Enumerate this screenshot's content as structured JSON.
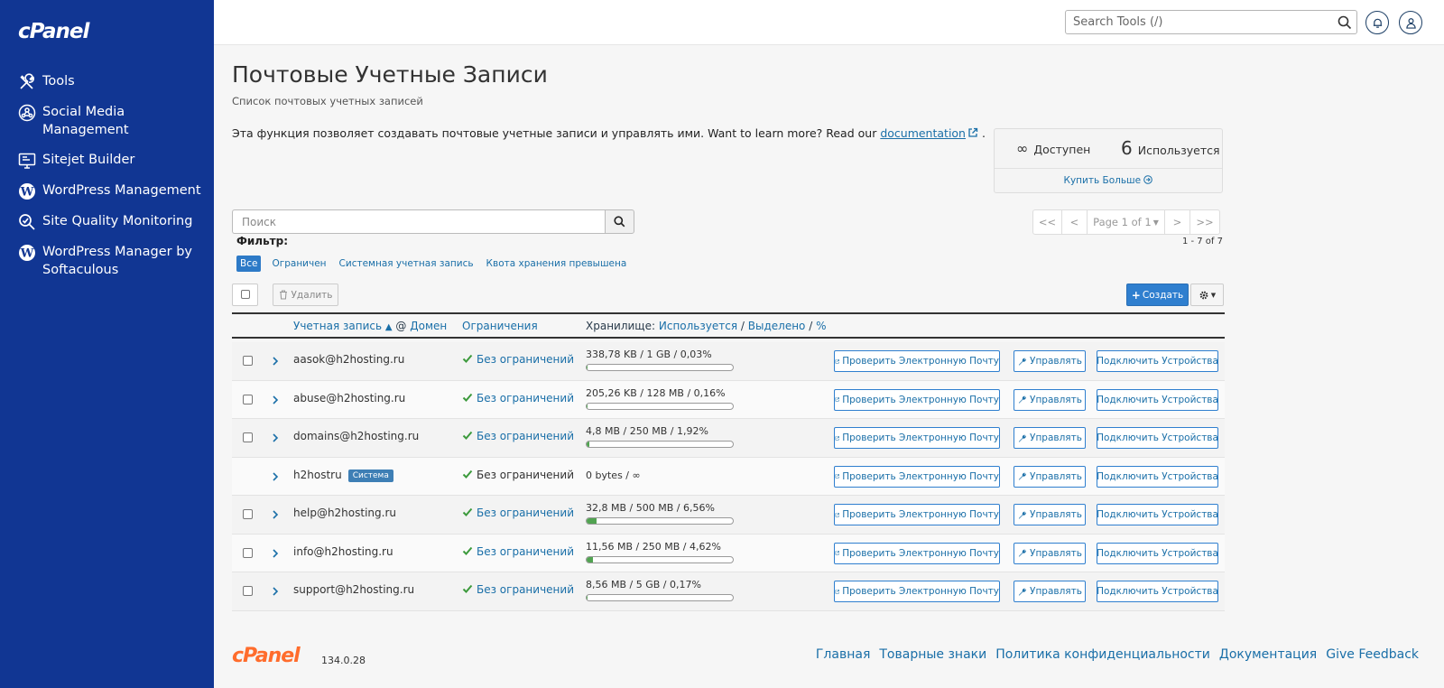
{
  "brand": {
    "logo": "cPanel",
    "footer_logo": "cPanel",
    "version": "134.0.28"
  },
  "sidebar": {
    "items": [
      {
        "label": "Tools",
        "icon": "tools-icon"
      },
      {
        "label": "Social Media Management",
        "icon": "social-media-icon"
      },
      {
        "label": "Sitejet Builder",
        "icon": "sitejet-icon"
      },
      {
        "label": "WordPress Management",
        "icon": "wordpress-icon"
      },
      {
        "label": "Site Quality Monitoring",
        "icon": "magnifier-icon"
      },
      {
        "label": "WordPress Manager by Softaculous",
        "icon": "wordpress-icon"
      }
    ]
  },
  "topbar": {
    "search_placeholder": "Search Tools (/)"
  },
  "page": {
    "title": "Почтовые Учетные Записи",
    "subtitle": "Список почтовых учетных записей",
    "intro": "Эта функция позволяет создавать почтовые учетные записи и управлять ими. Want to learn more? Read our ",
    "intro_link": "documentation",
    "intro_end": "."
  },
  "stats": {
    "available_value": "∞",
    "available_label": "Доступен",
    "used_value": "6",
    "used_label": "Используется",
    "buy_more": "Купить Больше"
  },
  "search": {
    "placeholder": "Поиск"
  },
  "pagination": {
    "first": "<<",
    "prev": "<",
    "page": "Page 1 of 1",
    "next": ">",
    "last": ">>",
    "range": "1 - 7 of 7"
  },
  "filter": {
    "label": "Фильтр:",
    "options": [
      "Все",
      "Ограничен",
      "Системная учетная запись",
      "Квота хранения превышена"
    ]
  },
  "toolbar": {
    "delete": "Удалить",
    "create": "Создать"
  },
  "table": {
    "header": {
      "account": "Учетная запись",
      "at": "@",
      "domain": "Домен",
      "limits": "Ограничения",
      "storage": "Хранилище:",
      "used": "Используется",
      "sep1": "/",
      "allocated": "Выделено",
      "sep2": "/",
      "percent": "%"
    },
    "buttons": {
      "check": "Проверить Электронную Почту",
      "manage": "Управлять",
      "connect": "Подключить Устройства"
    },
    "rows": [
      {
        "account": "aasok@h2hosting.ru",
        "limit": "Без ограничений",
        "storage": "338,78 KB / 1 GB / 0,03%",
        "usage": 0.0003
      },
      {
        "account": "abuse@h2hosting.ru",
        "limit": "Без ограничений",
        "storage": "205,26 KB / 128 MB / 0,16%",
        "usage": 0.0016
      },
      {
        "account": "domains@h2hosting.ru",
        "limit": "Без ограничений",
        "storage": "4,8 MB / 250 MB / 1,92%",
        "usage": 0.0192
      },
      {
        "account": "h2hostru",
        "badge": "Система",
        "limit": "Без ограничений",
        "storage": "0 bytes / ∞",
        "system": true
      },
      {
        "account": "help@h2hosting.ru",
        "limit": "Без ограничений",
        "storage": "32,8 MB / 500 MB / 6,56%",
        "usage": 0.0656
      },
      {
        "account": "info@h2hosting.ru",
        "limit": "Без ограничений",
        "storage": "11,56 MB / 250 MB / 4,62%",
        "usage": 0.0462
      },
      {
        "account": "support@h2hosting.ru",
        "limit": "Без ограничений",
        "storage": "8,56 MB / 5 GB / 0,17%",
        "usage": 0.0017
      }
    ]
  },
  "footer": {
    "links": [
      "Главная",
      "Товарные знаки",
      "Политика конфиденциальности",
      "Документация",
      "Give Feedback"
    ]
  }
}
